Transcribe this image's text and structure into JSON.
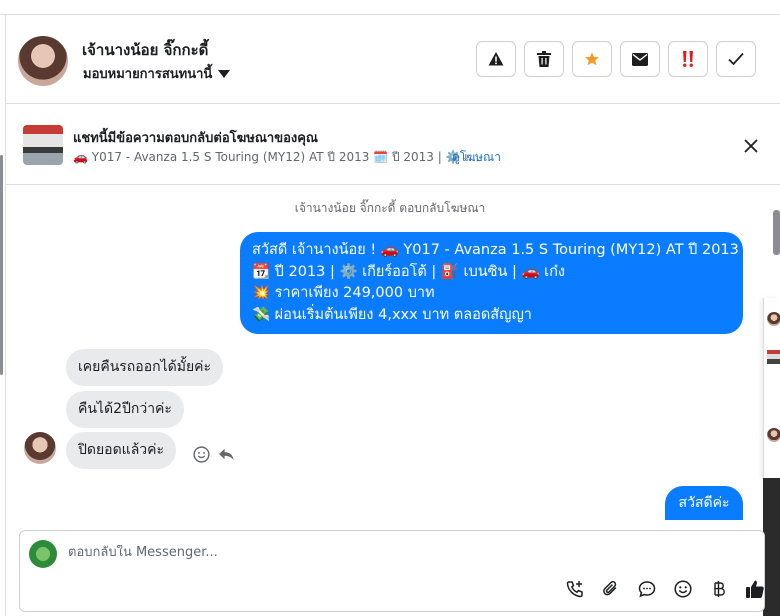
{
  "contact": {
    "name": "เจ้านางน้อย จิ๊กกะดี้",
    "assign_label": "มอบหมายการสนทนานี้"
  },
  "ad_banner": {
    "title": "แชทนี้มีข้อความตอบกลับต่อโฆษณาของคุณ",
    "subtitle": "🚗 Y017 - Avanza 1.5 S Touring (MY12) AT ปี 2013 🗓️ ปี 2013 | ⚙️ เ...",
    "view_ad_link": "ดูโฆษณา"
  },
  "chat": {
    "system_note": "เจ้านางน้อย จิ๊กกะดี้ ตอบกลับโฆษณา",
    "outgoing_ad_message": [
      "สวัสดี เจ้านางน้อย ! 🚗 Y017 - Avanza 1.5 S Touring (MY12) AT ปี 2013",
      "📆 ปี 2013 | ⚙️ เกียร์ออโต้ | ⛽ เบนซิน | 🚗 เก๋ง",
      "💥 ราคาเพียง 249,000 บาท",
      "💸 ผ่อนเริ่มต้นเพียง 4,xxx บาท ตลอดสัญญา"
    ],
    "incoming": [
      "เคยคืนรถออกได้มั้ยค่ะ",
      "คืนได้2ปีกว่าค่ะ",
      "ปิดยอดแล้วค่ะ"
    ],
    "outgoing_last": "สวัสดีค่ะ"
  },
  "composer": {
    "placeholder": "ตอบกลับใน Messenger..."
  },
  "colors": {
    "accent": "#0a7cff",
    "incoming_bubble": "#e9eaec",
    "link": "#216fdb",
    "star": "#f59a23",
    "urgent": "#e02020"
  }
}
